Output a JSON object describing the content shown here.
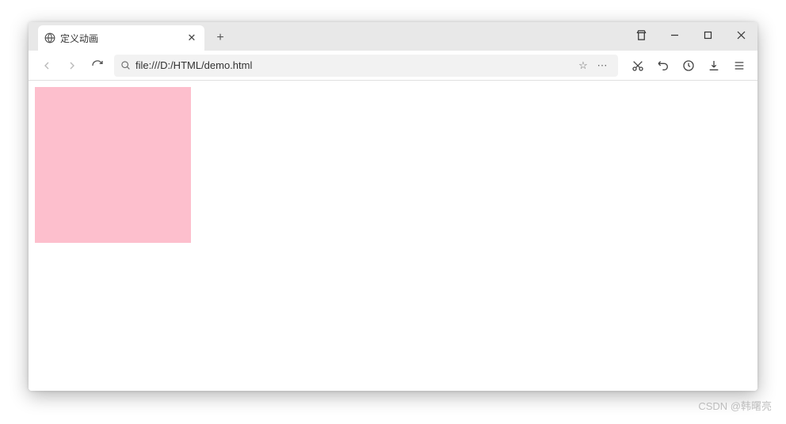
{
  "tab": {
    "title": "定义动画"
  },
  "address": {
    "url": "file:///D:/HTML/demo.html"
  },
  "content": {
    "box_color": "#fdbfcd"
  },
  "watermark": "CSDN @韩曙亮"
}
